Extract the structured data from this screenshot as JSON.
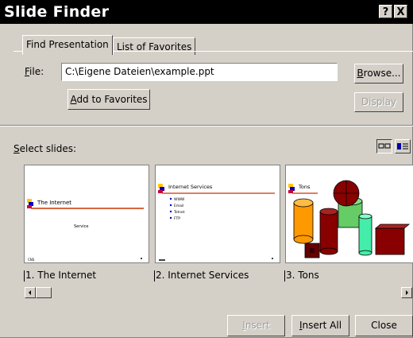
{
  "window": {
    "title": "Slide Finder",
    "help_glyph": "?",
    "close_glyph": "X"
  },
  "tabs": [
    {
      "label": "Find Presentation"
    },
    {
      "label": "List of Favorites"
    }
  ],
  "file": {
    "label_prefix": "F",
    "label_rest": "ile:",
    "value": "C:\\Eigene Dateien\\example.ppt",
    "browse_prefix": "B",
    "browse_rest": "rowse...",
    "add_prefix": "A",
    "add_rest": "dd to Favorites",
    "display_label": "Display"
  },
  "select": {
    "label_prefix": "S",
    "label_rest": "elect slides:"
  },
  "slides": [
    {
      "caption": "1. The Internet",
      "title": "The Internet",
      "subtitle": "Service",
      "footer": "CNS"
    },
    {
      "caption": "2. Internet Services",
      "title": "Internet Services",
      "bullets": [
        "WWW",
        "Email",
        "Telnet",
        "FTP"
      ]
    },
    {
      "caption": "3. Tons",
      "title": "Tons"
    }
  ],
  "footer": {
    "insert_prefix": "I",
    "insert_rest": "nsert",
    "insert_all_prefix": "I",
    "insert_all_rest": "nsert All",
    "close": "Close"
  },
  "colors": {
    "titlebar": "#000000",
    "face": "#d4d0c8",
    "accent_blue": "#0000aa"
  }
}
